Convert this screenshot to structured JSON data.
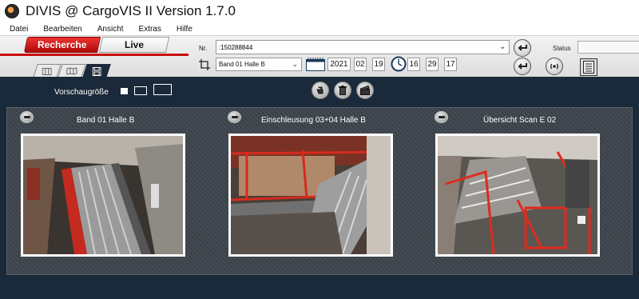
{
  "window": {
    "title": "DIVIS @ CargoVIS II Version 1.7.0"
  },
  "menu": [
    "Datei",
    "Bearbeiten",
    "Ansicht",
    "Extras",
    "Hilfe"
  ],
  "mode_tabs": {
    "recherche": "Recherche",
    "live": "Live"
  },
  "view_tabs": [
    {
      "icon": "grid-view-icon"
    },
    {
      "icon": "map-icon"
    },
    {
      "icon": "save-icon"
    }
  ],
  "search": {
    "label": "Nr.",
    "value": ":150288844"
  },
  "camera_select": {
    "value": "Band 01 Halle B"
  },
  "date": {
    "year": "2021",
    "month": "02",
    "day": "19"
  },
  "time": {
    "hour": "16",
    "minute": "29",
    "second": "17"
  },
  "status": {
    "label": "Status",
    "value": ""
  },
  "preview": {
    "label": "Vorschaugröße"
  },
  "cameras": [
    {
      "title": "Band 01 Halle B"
    },
    {
      "title": "Einschleusung 03+04 Halle B"
    },
    {
      "title": "Übersicht Scan E 02"
    }
  ],
  "colors": {
    "accent_red": "#c60b0b",
    "dark_bg": "#1b2a3a",
    "panel": "#40464d"
  }
}
